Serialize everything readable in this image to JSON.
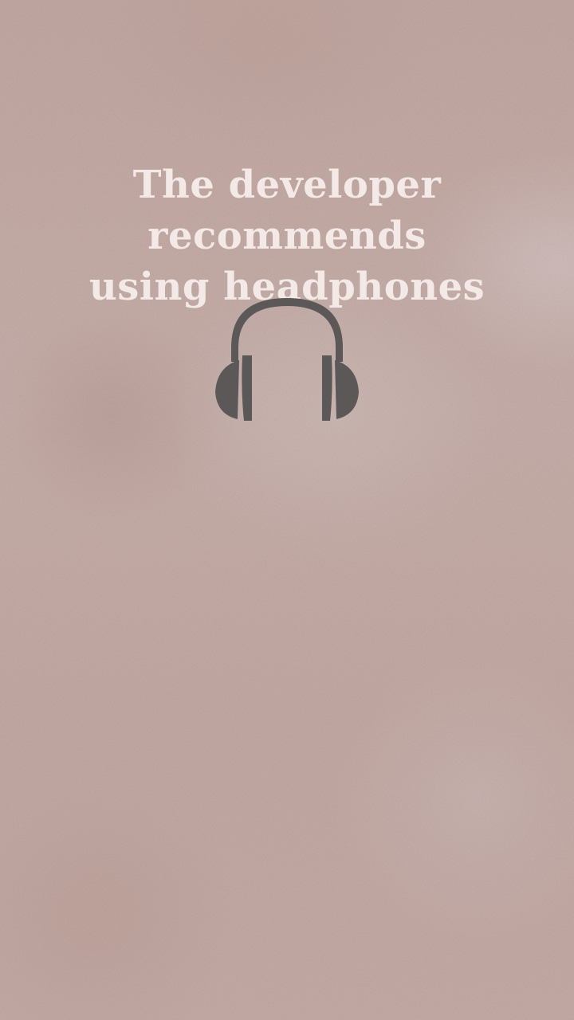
{
  "notice": {
    "line1": "The developer recommends",
    "line2": "using headphones"
  },
  "icon": {
    "name": "headphones-icon",
    "color": "#5c5858"
  },
  "colors": {
    "background": "#c6aba6",
    "text": "#f3e9e6"
  }
}
